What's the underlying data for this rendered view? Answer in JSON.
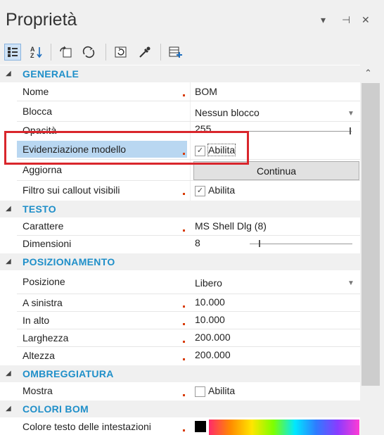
{
  "window": {
    "title": "Proprietà",
    "controls": [
      "▾",
      "⊣",
      "✕"
    ]
  },
  "toolbar": {
    "buttons": [
      {
        "icon": "categorized-view-icon",
        "selected": true
      },
      {
        "icon": "sort-az-icon"
      },
      {
        "icon": "pages-icon"
      },
      {
        "icon": "events-icon"
      },
      {
        "icon": "reset-icon"
      },
      {
        "icon": "eyedropper-icon"
      },
      {
        "icon": "add-property-icon"
      }
    ]
  },
  "categories": {
    "generale": "GENERALE",
    "testo": "TESTO",
    "posizionamento": "POSIZIONAMENTO",
    "ombreggiatura": "OMBREGGIATURA",
    "colori_bom": "COLORI BOM"
  },
  "props": {
    "nome": {
      "label": "Nome",
      "value": "BOM"
    },
    "blocca": {
      "label": "Blocca",
      "value": "Nessun blocco"
    },
    "opacita": {
      "label": "Opacità",
      "value": "255"
    },
    "evidenziazione": {
      "label": "Evidenziazione modello",
      "value": "Abilita",
      "checked": true
    },
    "aggiorna": {
      "label": "Aggiorna",
      "button": "Continua"
    },
    "filtro": {
      "label": "Filtro sui callout visibili",
      "value": "Abilita",
      "checked": true
    },
    "carattere": {
      "label": "Carattere",
      "value": "MS Shell Dlg (8)"
    },
    "dimensioni": {
      "label": "Dimensioni",
      "value": "8"
    },
    "posizione": {
      "label": "Posizione",
      "value": "Libero"
    },
    "a_sinistra": {
      "label": "A sinistra",
      "value": "10.000"
    },
    "in_alto": {
      "label": "In alto",
      "value": "10.000"
    },
    "larghezza": {
      "label": "Larghezza",
      "value": "200.000"
    },
    "altezza": {
      "label": "Altezza",
      "value": "200.000"
    },
    "mostra": {
      "label": "Mostra",
      "value": "Abilita",
      "checked": false
    },
    "colore_testo": {
      "label": "Colore testo delle intestazioni"
    }
  },
  "colors": {
    "category_text": "#1f8fc9",
    "highlight_border": "#d9262c",
    "modified_marker": "#d83b01",
    "selection": "#b9d7f1"
  }
}
